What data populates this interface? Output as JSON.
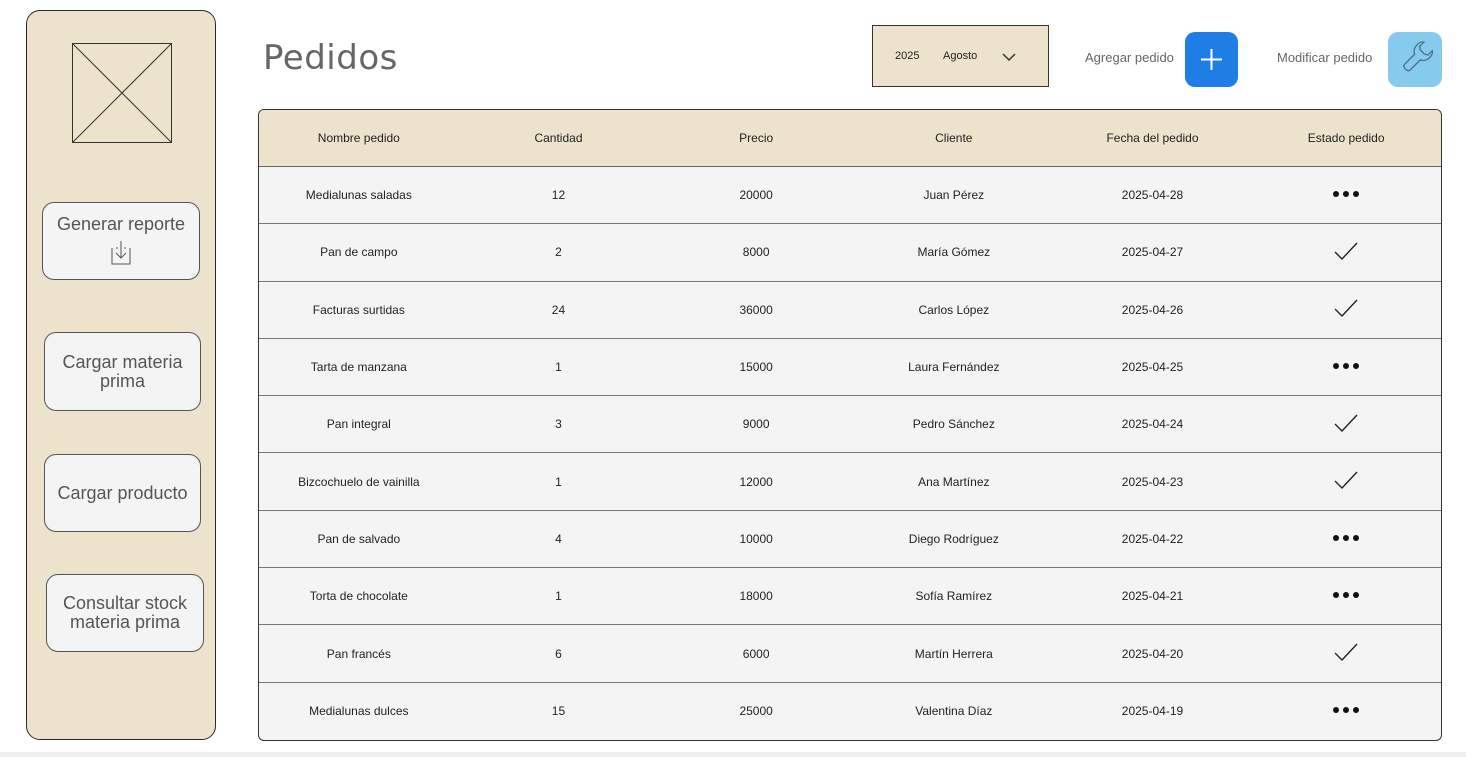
{
  "sidebar": {
    "logo_icon": "image-placeholder-icon",
    "buttons": [
      {
        "label": "Generar reporte",
        "icon": "download-icon"
      },
      {
        "label_line1": "Cargar materia",
        "label_line2": "prima"
      },
      {
        "label": "Cargar producto"
      },
      {
        "label_line1": "Consultar stock",
        "label_line2": "materia prima"
      }
    ]
  },
  "header": {
    "title": "Pedidos",
    "period": {
      "year": "2025",
      "month": "Agosto"
    },
    "add_label": "Agregar pedido",
    "add_icon": "plus-icon",
    "edit_label": "Modificar pedido",
    "edit_icon": "wrench-icon"
  },
  "colors": {
    "sidebar_bg": "#ede2cb",
    "add_button": "#1e7ee6",
    "edit_button": "#86cbed",
    "row_bg": "#f4f4f4"
  },
  "table": {
    "columns": [
      "Nombre pedido",
      "Cantidad",
      "Precio",
      "Cliente",
      "Fecha del pedido",
      "Estado pedido"
    ],
    "rows": [
      {
        "nombre": "Medialunas saladas",
        "cantidad": "12",
        "precio": "20000",
        "cliente": "Juan Pérez",
        "fecha": "2025-04-28",
        "estado": "pending"
      },
      {
        "nombre": "Pan de campo",
        "cantidad": "2",
        "precio": "8000",
        "cliente": "María Gómez",
        "fecha": "2025-04-27",
        "estado": "done"
      },
      {
        "nombre": "Facturas surtidas",
        "cantidad": "24",
        "precio": "36000",
        "cliente": "Carlos López",
        "fecha": "2025-04-26",
        "estado": "done"
      },
      {
        "nombre": "Tarta de manzana",
        "cantidad": "1",
        "precio": "15000",
        "cliente": "Laura Fernández",
        "fecha": "2025-04-25",
        "estado": "pending"
      },
      {
        "nombre": "Pan integral",
        "cantidad": "3",
        "precio": "9000",
        "cliente": "Pedro Sánchez",
        "fecha": "2025-04-24",
        "estado": "done"
      },
      {
        "nombre": "Bizcochuelo de vainilla",
        "cantidad": "1",
        "precio": "12000",
        "cliente": "Ana Martínez",
        "fecha": "2025-04-23",
        "estado": "done"
      },
      {
        "nombre": "Pan de salvado",
        "cantidad": "4",
        "precio": "10000",
        "cliente": "Diego Rodríguez",
        "fecha": "2025-04-22",
        "estado": "pending"
      },
      {
        "nombre": "Torta de chocolate",
        "cantidad": "1",
        "precio": "18000",
        "cliente": "Sofía Ramírez",
        "fecha": "2025-04-21",
        "estado": "pending"
      },
      {
        "nombre": "Pan francés",
        "cantidad": "6",
        "precio": "6000",
        "cliente": "Martín Herrera",
        "fecha": "2025-04-20",
        "estado": "done"
      },
      {
        "nombre": "Medialunas dulces",
        "cantidad": "15",
        "precio": "25000",
        "cliente": "Valentina Díaz",
        "fecha": "2025-04-19",
        "estado": "pending"
      }
    ]
  }
}
